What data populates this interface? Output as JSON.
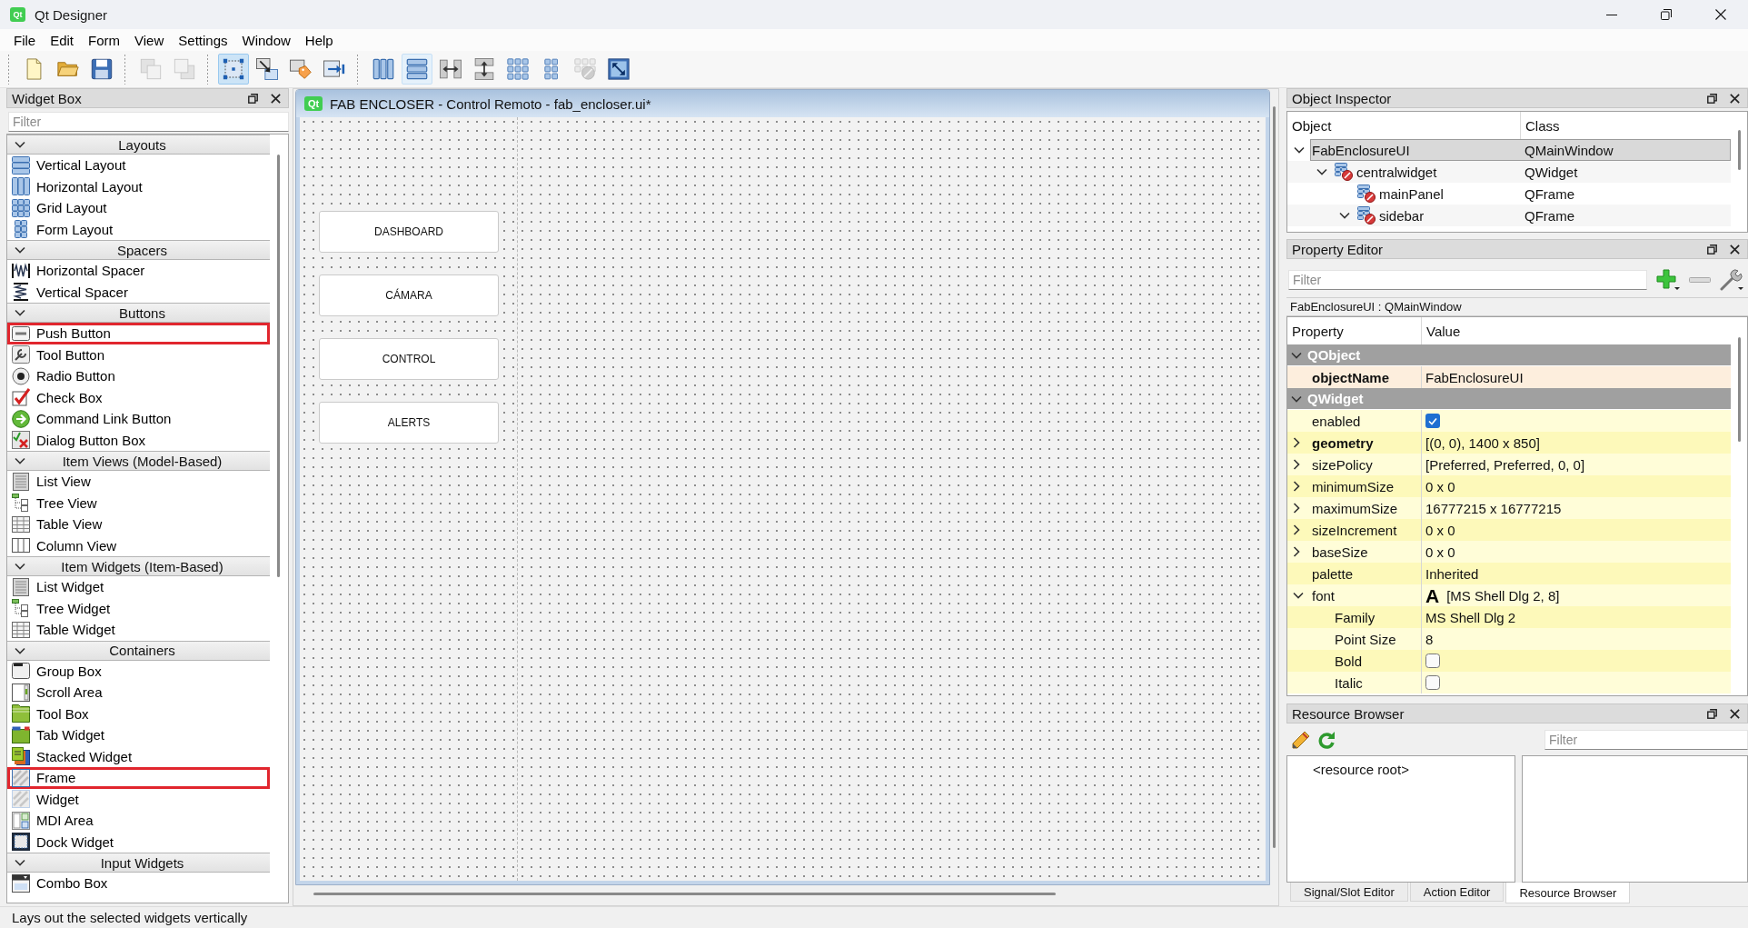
{
  "window": {
    "logo": "Qt",
    "title": "Qt Designer"
  },
  "menu": [
    "File",
    "Edit",
    "Form",
    "View",
    "Settings",
    "Window",
    "Help"
  ],
  "toolbar": [
    [
      {
        "kind": "new",
        "hovered": false,
        "disabled": false
      },
      {
        "kind": "open",
        "hovered": false,
        "disabled": false
      },
      {
        "kind": "save",
        "hovered": false,
        "disabled": false
      }
    ],
    [
      {
        "kind": "front",
        "hovered": false,
        "disabled": true
      },
      {
        "kind": "back",
        "hovered": false,
        "disabled": true
      }
    ],
    [
      {
        "kind": "widgets",
        "selected": true,
        "hovered": false,
        "disabled": false
      },
      {
        "kind": "signals",
        "selected": false,
        "hovered": false,
        "disabled": false
      },
      {
        "kind": "buddies",
        "selected": false,
        "hovered": false,
        "disabled": false
      },
      {
        "kind": "taborder",
        "selected": false,
        "hovered": false,
        "disabled": false
      }
    ],
    [
      {
        "kind": "hlayout",
        "hovered": false,
        "disabled": false
      },
      {
        "kind": "vlayout",
        "hovered": true,
        "disabled": false
      },
      {
        "kind": "hsplit",
        "hovered": false,
        "disabled": false
      },
      {
        "kind": "vsplit",
        "hovered": false,
        "disabled": false
      },
      {
        "kind": "grid",
        "hovered": false,
        "disabled": false
      },
      {
        "kind": "form",
        "hovered": false,
        "disabled": false
      },
      {
        "kind": "break",
        "hovered": false,
        "disabled": true
      },
      {
        "kind": "adjust",
        "hovered": false,
        "disabled": false
      }
    ]
  ],
  "widget_box": {
    "title": "Widget Box",
    "filter": {
      "placeholder": "Filter"
    },
    "categories": [
      {
        "title": "Layouts",
        "expanded": true,
        "items": [
          {
            "label": "Vertical Layout",
            "kind": "vlayout",
            "highlighted": false
          },
          {
            "label": "Horizontal Layout",
            "kind": "hlayout",
            "highlighted": false
          },
          {
            "label": "Grid Layout",
            "kind": "grid",
            "highlighted": false
          },
          {
            "label": "Form Layout",
            "kind": "form",
            "highlighted": false
          }
        ]
      },
      {
        "title": "Spacers",
        "expanded": true,
        "items": [
          {
            "label": "Horizontal Spacer",
            "kind": "hspacer",
            "highlighted": false
          },
          {
            "label": "Vertical Spacer",
            "kind": "vspacer",
            "highlighted": false
          }
        ]
      },
      {
        "title": "Buttons",
        "expanded": true,
        "items": [
          {
            "label": "Push Button",
            "kind": "pushbutton",
            "highlighted": true
          },
          {
            "label": "Tool Button",
            "kind": "toolbutton",
            "highlighted": false
          },
          {
            "label": "Radio Button",
            "kind": "radio",
            "highlighted": false
          },
          {
            "label": "Check Box",
            "kind": "checkbox",
            "highlighted": false
          },
          {
            "label": "Command Link Button",
            "kind": "commandlink",
            "highlighted": false
          },
          {
            "label": "Dialog Button Box",
            "kind": "dialogbuttons",
            "highlighted": false
          }
        ]
      },
      {
        "title": "Item Views (Model-Based)",
        "expanded": true,
        "items": [
          {
            "label": "List View",
            "kind": "list",
            "highlighted": false
          },
          {
            "label": "Tree View",
            "kind": "tree",
            "highlighted": false
          },
          {
            "label": "Table View",
            "kind": "table",
            "highlighted": false
          },
          {
            "label": "Column View",
            "kind": "columnview",
            "highlighted": false
          }
        ]
      },
      {
        "title": "Item Widgets (Item-Based)",
        "expanded": true,
        "items": [
          {
            "label": "List Widget",
            "kind": "list",
            "highlighted": false
          },
          {
            "label": "Tree Widget",
            "kind": "tree",
            "highlighted": false
          },
          {
            "label": "Table Widget",
            "kind": "table",
            "highlighted": false
          }
        ]
      },
      {
        "title": "Containers",
        "expanded": true,
        "items": [
          {
            "label": "Group Box",
            "kind": "groupbox",
            "highlighted": false
          },
          {
            "label": "Scroll Area",
            "kind": "scrollarea",
            "highlighted": false
          },
          {
            "label": "Tool Box",
            "kind": "toolbox",
            "highlighted": false
          },
          {
            "label": "Tab Widget",
            "kind": "tabwidget",
            "highlighted": false
          },
          {
            "label": "Stacked Widget",
            "kind": "stacked",
            "highlighted": false
          },
          {
            "label": "Frame",
            "kind": "frame",
            "highlighted": true
          },
          {
            "label": "Widget",
            "kind": "widget",
            "highlighted": false
          },
          {
            "label": "MDI Area",
            "kind": "mdi",
            "highlighted": false
          },
          {
            "label": "Dock Widget",
            "kind": "dock",
            "highlighted": false
          }
        ]
      },
      {
        "title": "Input Widgets",
        "expanded": true,
        "items": [
          {
            "label": "Combo Box",
            "kind": "combo",
            "highlighted": false
          }
        ]
      }
    ]
  },
  "form_window": {
    "logo": "Qt",
    "title": "FAB ENCLOSER - Control Remoto - fab_encloser.ui*",
    "buttons": [
      "DASHBOARD",
      "CÁMARA",
      "CONTROL",
      "ALERTS"
    ]
  },
  "object_inspector": {
    "title": "Object Inspector",
    "columns": [
      "Object",
      "Class"
    ],
    "objects": [
      {
        "name": "FabEnclosureUI",
        "class": "QMainWindow",
        "selected": true,
        "expanded": true,
        "no_layout": false,
        "children": [
          {
            "name": "centralwidget",
            "class": "QWidget",
            "selected": false,
            "expanded": true,
            "no_layout": true,
            "children": [
              {
                "name": "mainPanel",
                "class": "QFrame",
                "selected": false,
                "no_layout": true
              },
              {
                "name": "sidebar",
                "class": "QFrame",
                "selected": false,
                "expanded": true,
                "no_layout": true
              }
            ]
          }
        ]
      }
    ]
  },
  "property_editor": {
    "title": "Property Editor",
    "filter": {
      "placeholder": "Filter"
    },
    "current_object": "FabEnclosureUI : QMainWindow",
    "columns": [
      "Property",
      "Value"
    ],
    "groups": [
      {
        "name": "QObject",
        "color": "#fdeedd",
        "expanded": true,
        "properties": [
          {
            "name": "objectName",
            "kind": "text",
            "value": "FabEnclosureUI",
            "changed": true
          }
        ]
      },
      {
        "name": "QWidget",
        "color": "#fffdd8",
        "expanded": true,
        "properties": [
          {
            "name": "enabled",
            "kind": "check",
            "checked": true,
            "changed": false
          },
          {
            "name": "geometry",
            "kind": "text",
            "value": "[(0, 0), 1400 x 850]",
            "changed": true,
            "expanded": false
          },
          {
            "name": "sizePolicy",
            "kind": "text",
            "value": "[Preferred, Preferred, 0, 0]",
            "changed": false,
            "expanded": false
          },
          {
            "name": "minimumSize",
            "kind": "text",
            "value": "0 x 0",
            "changed": false,
            "expanded": false
          },
          {
            "name": "maximumSize",
            "kind": "text",
            "value": "16777215 x 16777215",
            "changed": false,
            "expanded": false
          },
          {
            "name": "sizeIncrement",
            "kind": "text",
            "value": "0 x 0",
            "changed": false,
            "expanded": false
          },
          {
            "name": "baseSize",
            "kind": "text",
            "value": "0 x 0",
            "changed": false,
            "expanded": false
          },
          {
            "name": "palette",
            "kind": "text",
            "value": "Inherited",
            "changed": false
          },
          {
            "name": "font",
            "kind": "font",
            "preview": "A",
            "value": "[MS Shell Dlg 2, 8]",
            "changed": false,
            "expanded": true,
            "children": [
              {
                "name": "Family",
                "kind": "text",
                "value": "MS Shell Dlg 2",
                "changed": false
              },
              {
                "name": "Point Size",
                "kind": "text",
                "value": "8",
                "changed": false
              },
              {
                "name": "Bold",
                "kind": "check",
                "checked": false,
                "changed": false
              },
              {
                "name": "Italic",
                "kind": "check",
                "checked": false,
                "changed": false
              }
            ]
          }
        ]
      }
    ]
  },
  "resource_browser": {
    "title": "Resource Browser",
    "filter": {
      "placeholder": "Filter"
    },
    "root": "<resource root>"
  },
  "bottom_tabs": [
    {
      "label": "Signal/Slot Editor",
      "selected": false
    },
    {
      "label": "Action Editor",
      "selected": false
    },
    {
      "label": "Resource Browser",
      "selected": true
    }
  ],
  "status_bar": {
    "text": "Lays out the selected widgets vertically"
  }
}
